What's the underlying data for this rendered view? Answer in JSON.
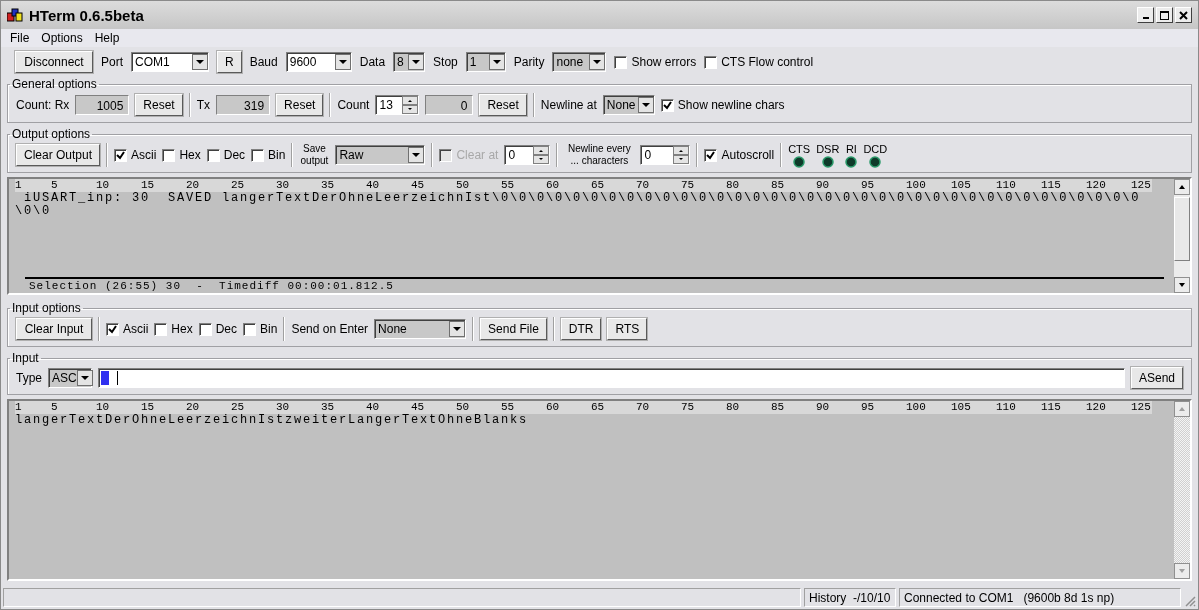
{
  "window": {
    "title": "HTerm 0.6.5beta"
  },
  "menu": [
    "File",
    "Options",
    "Help"
  ],
  "connection": {
    "connect_button": "Disconnect",
    "port_label": "Port",
    "port": "COM1",
    "refresh_button": "R",
    "baud_label": "Baud",
    "baud": "9600",
    "data_label": "Data",
    "data": "8",
    "stop_label": "Stop",
    "stop": "1",
    "parity_label": "Parity",
    "parity": "none",
    "checks": [
      {
        "label": "Show errors",
        "checked": false
      },
      {
        "label": "CTS Flow control",
        "checked": false
      }
    ]
  },
  "general_options": {
    "title": "General options",
    "rx_label": "Count: Rx",
    "rx": "1005",
    "rx_reset": "Reset",
    "tx_label": "Tx",
    "tx": "319",
    "tx_reset": "Reset",
    "count_label": "Count",
    "count": "13",
    "counter": "0",
    "count_reset": "Reset",
    "newline_label": "Newline at",
    "newline": "None",
    "show_newline": {
      "label": "Show newline chars",
      "checked": true
    }
  },
  "output_options": {
    "title": "Output options",
    "clear_button": "Clear Output",
    "formats": [
      {
        "label": "Ascii",
        "checked": true
      },
      {
        "label": "Hex",
        "checked": false
      },
      {
        "label": "Dec",
        "checked": false
      },
      {
        "label": "Bin",
        "checked": false
      }
    ],
    "save_label": "Save output",
    "save_output": "Raw",
    "clear_at": {
      "label": "Clear at",
      "checked": false,
      "disabled": true
    },
    "clear_at_value": "0",
    "newline_every_label": "Newline every ... characters",
    "newline_every": "0",
    "autoscroll": {
      "label": "Autoscroll",
      "checked": true
    },
    "signals": [
      {
        "label": "CTS"
      },
      {
        "label": "DSR"
      },
      {
        "label": "RI"
      },
      {
        "label": "DCD"
      }
    ]
  },
  "output": {
    "ruler": [
      "1",
      "5",
      "10",
      "15",
      "20",
      "25",
      "30",
      "35",
      "40",
      "45",
      "50",
      "55",
      "60",
      "65",
      "70",
      "75",
      "80",
      "85",
      "90",
      "95",
      "100",
      "105",
      "110",
      "115",
      "120",
      "125"
    ],
    "lines": [
      " iUSART_inp: 30  SAVED langerTextDerOhneLeerzeichnIst\\0\\0\\0\\0\\0\\0\\0\\0\\0\\0\\0\\0\\0\\0\\0\\0\\0\\0\\0\\0\\0\\0\\0\\0\\0\\0\\0\\0\\0\\0\\0\\0\\0\\0\\0\\0",
      "\\0\\0"
    ],
    "selection": "Selection (26:55) 30  -  Timediff 00:00:01.812.5"
  },
  "input_options": {
    "title": "Input options",
    "clear_button": "Clear Input",
    "formats": [
      {
        "label": "Ascii",
        "checked": true
      },
      {
        "label": "Hex",
        "checked": false
      },
      {
        "label": "Dec",
        "checked": false
      },
      {
        "label": "Bin",
        "checked": false
      }
    ],
    "send_on_enter_label": "Send on Enter",
    "send_on_enter": "None",
    "send_file_button": "Send File",
    "dtr_button": "DTR",
    "rts_button": "RTS"
  },
  "input": {
    "title": "Input",
    "type_label": "Type",
    "type": "ASC",
    "send_button": "ASend"
  },
  "input_view": {
    "ruler": [
      "1",
      "5",
      "10",
      "15",
      "20",
      "25",
      "30",
      "35",
      "40",
      "45",
      "50",
      "55",
      "60",
      "65",
      "70",
      "75",
      "80",
      "85",
      "90",
      "95",
      "100",
      "105",
      "110",
      "115",
      "120",
      "125"
    ],
    "lines": [
      "langerTextDerOhneLeerzeichnIstzweiterLangerTextOhneBlanks"
    ]
  },
  "status_bar": {
    "history": "History  -/10/10",
    "connection": "Connected to COM1   (9600b 8d 1s np)"
  }
}
